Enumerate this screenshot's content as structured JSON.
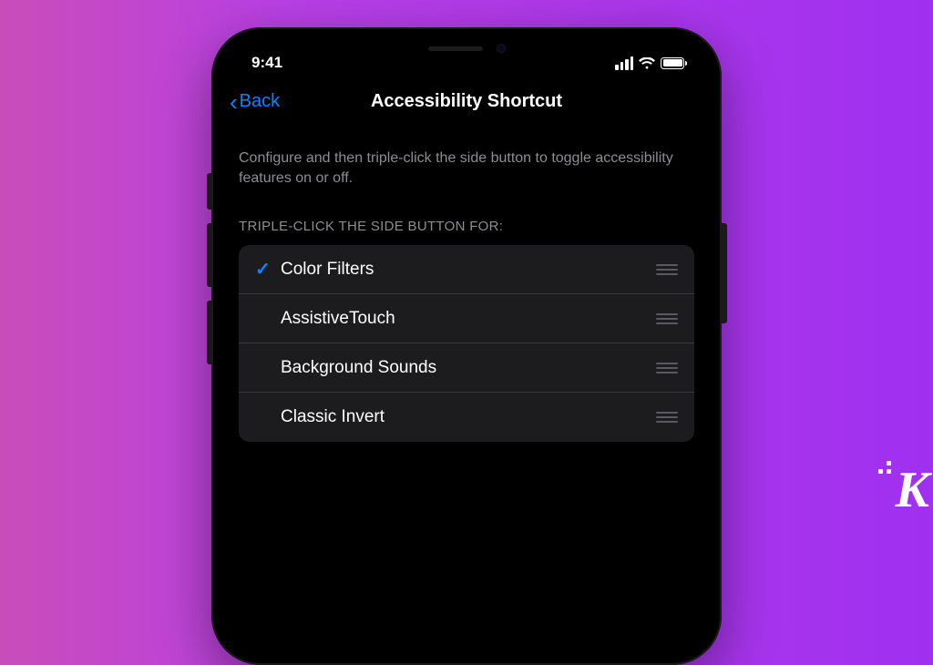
{
  "statusbar": {
    "time": "9:41"
  },
  "navbar": {
    "back_label": "Back",
    "title": "Accessibility Shortcut"
  },
  "description": "Configure and then triple-click the side button to toggle accessibility features on or off.",
  "section_header": "TRIPLE-CLICK THE SIDE BUTTON FOR:",
  "items": [
    {
      "label": "Color Filters",
      "checked": true
    },
    {
      "label": "AssistiveTouch",
      "checked": false
    },
    {
      "label": "Background Sounds",
      "checked": false
    },
    {
      "label": "Classic Invert",
      "checked": false
    }
  ],
  "watermark": "K"
}
